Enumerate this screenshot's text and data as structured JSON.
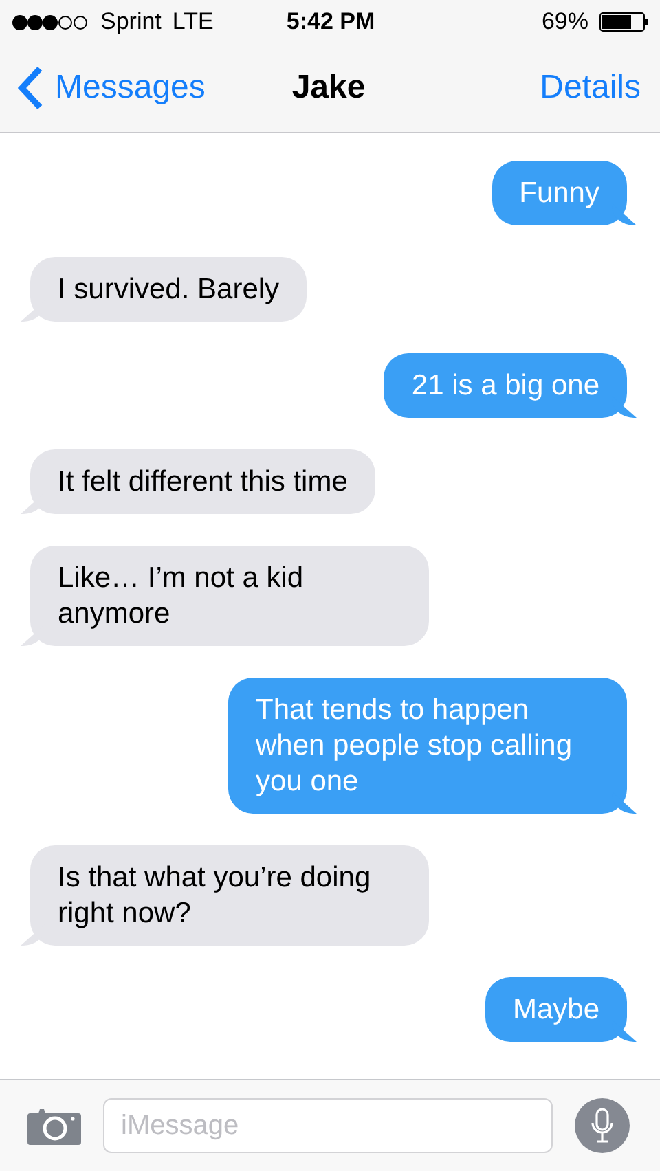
{
  "status_bar": {
    "carrier": "Sprint",
    "network": "LTE",
    "time": "5:42 PM",
    "battery": "69%"
  },
  "nav": {
    "back": "Messages",
    "title": "Jake",
    "action": "Details"
  },
  "messages": [
    {
      "kind": "sent",
      "text": "Funny"
    },
    {
      "kind": "received",
      "text": "I survived. Barely"
    },
    {
      "kind": "sent",
      "text": "21 is a big one"
    },
    {
      "kind": "received",
      "text": "It felt different this time"
    },
    {
      "kind": "received",
      "text": "Like… I’m not a kid anymore"
    },
    {
      "kind": "sent",
      "text": "That tends to happen when people stop calling you one"
    },
    {
      "kind": "received",
      "text": "Is that what you’re doing right now?"
    },
    {
      "kind": "sent",
      "text": "Maybe"
    }
  ],
  "input": {
    "placeholder": "iMessage"
  }
}
